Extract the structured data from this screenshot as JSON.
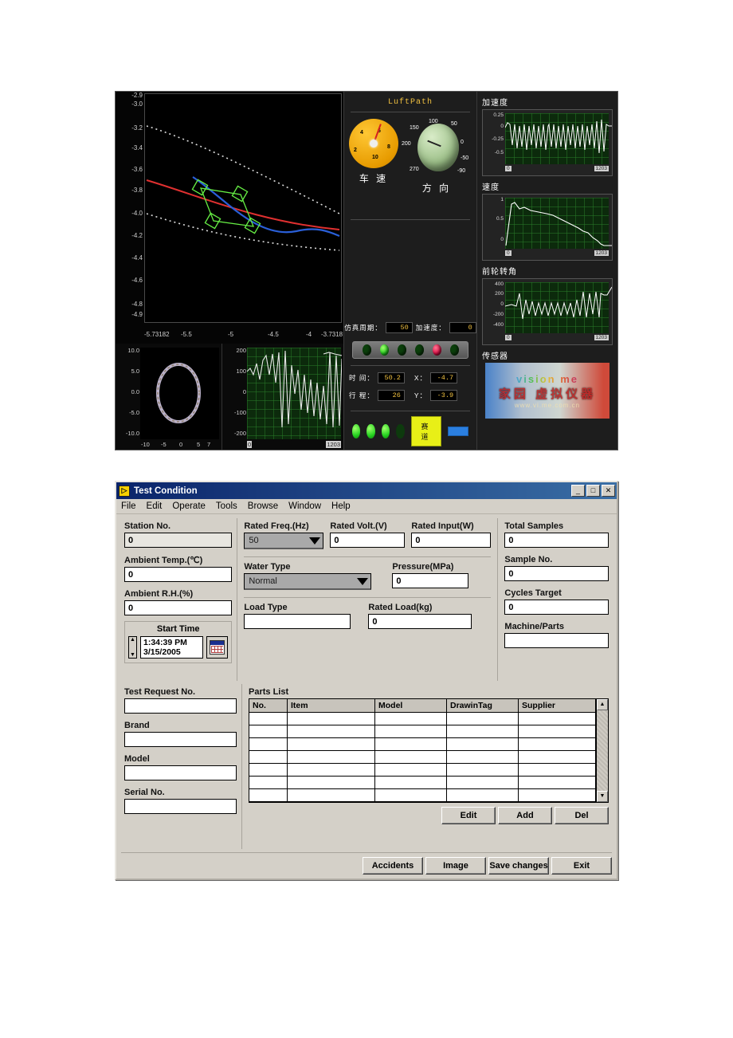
{
  "instrument_panel": {
    "title": "LuftPath",
    "main_plot": {
      "y_ticks": [
        "-2.9",
        "-3.0",
        "-3.2",
        "-3.4",
        "-3.6",
        "-3.8",
        "-4.0",
        "-4.2",
        "-4.4",
        "-4.6",
        "-4.8",
        "-4.9"
      ],
      "x_ticks": [
        "-5.73182",
        "-5.5",
        "-5",
        "-4.5",
        "-4",
        "-3.7318"
      ]
    },
    "mini_track": {
      "y_ticks": [
        "10.0",
        "5.0",
        "0.0",
        "-5.0",
        "-10.0"
      ],
      "x_ticks": [
        "-10",
        "-5",
        "0",
        "5",
        "7"
      ]
    },
    "mini_wave": {
      "y_ticks": [
        "200",
        "100",
        "0",
        "-100",
        "-200"
      ],
      "x_start": "0",
      "x_end": "1203"
    },
    "gauges": {
      "speed": {
        "label": "车 速",
        "ticks": [
          "2",
          "4",
          "6",
          "8",
          "10"
        ]
      },
      "direction": {
        "label": "方 向",
        "ticks": [
          "100",
          "150",
          "50",
          "200",
          "0",
          "270",
          "-50",
          "-90"
        ]
      }
    },
    "readouts": {
      "sim_cycle_label": "仿真周期：",
      "sim_cycle_value": "50",
      "accel_label": "加速度：",
      "accel_value": "0",
      "time_label": "时 间：",
      "time_value": "50.2",
      "x_label": "X：",
      "x_value": "-4.7",
      "distance_label": "行 程：",
      "distance_value": "26",
      "y_label": "Y：",
      "y_value": "-3.9"
    },
    "buttons": {
      "track": "赛道",
      "blue": ""
    },
    "charts": [
      {
        "title": "加速度",
        "y_ticks": [
          "0.25",
          "0",
          "-0.25",
          "-0.5"
        ],
        "x_start": "0",
        "x_end": "1203"
      },
      {
        "title": "速度",
        "y_ticks": [
          "1",
          "0.5",
          "0"
        ],
        "x_start": "0",
        "x_end": "1203"
      },
      {
        "title": "前轮转角",
        "y_ticks": [
          "400",
          "200",
          "0",
          "-200",
          "-400"
        ],
        "x_start": "0",
        "x_end": "1203"
      }
    ],
    "sensor": {
      "title": "传感器",
      "watermark_line1": "vision me",
      "watermark_line2": "家园 虚拟仪器",
      "watermark_line3": "www.vi.me.com.cn"
    }
  },
  "dialog": {
    "title": "Test Condition",
    "window_buttons": {
      "minimize": "_",
      "maximize": "□",
      "close": "✕"
    },
    "menu": [
      "File",
      "Edit",
      "Operate",
      "Tools",
      "Browse",
      "Window",
      "Help"
    ],
    "left_column": {
      "station_no_label": "Station No.",
      "station_no_value": "0",
      "ambient_temp_label": "Ambient Temp.(℃)",
      "ambient_temp_value": "0",
      "ambient_rh_label": "Ambient R.H.(%)",
      "ambient_rh_value": "0",
      "start_time_label": "Start Time",
      "start_time_time": "1:34:39 PM",
      "start_time_date": "3/15/2005"
    },
    "middle_column": {
      "rated_freq_label": "Rated Freq.(Hz)",
      "rated_freq_value": "50",
      "rated_volt_label": "Rated Volt.(V)",
      "rated_volt_value": "0",
      "rated_input_label": "Rated Input(W)",
      "rated_input_value": "0",
      "water_type_label": "Water Type",
      "water_type_value": "Normal",
      "pressure_label": "Pressure(MPa)",
      "pressure_value": "0",
      "load_type_label": "Load Type",
      "load_type_value": "",
      "rated_load_label": "Rated Load(kg)",
      "rated_load_value": "0"
    },
    "right_column": {
      "total_samples_label": "Total Samples",
      "total_samples_value": "0",
      "sample_no_label": "Sample No.",
      "sample_no_value": "0",
      "cycles_target_label": "Cycles Target",
      "cycles_target_value": "0",
      "machine_parts_label": "Machine/Parts",
      "machine_parts_value": ""
    },
    "bottom_left": {
      "test_request_label": "Test Request No.",
      "test_request_value": "",
      "brand_label": "Brand",
      "brand_value": "",
      "model_label": "Model",
      "model_value": "",
      "serial_label": "Serial No.",
      "serial_value": ""
    },
    "parts_list": {
      "title": "Parts List",
      "columns": [
        "No.",
        "Item",
        "Model",
        "DrawinTag",
        "Supplier"
      ],
      "rows": [
        [
          "",
          "",
          "",
          "",
          ""
        ],
        [
          "",
          "",
          "",
          "",
          ""
        ],
        [
          "",
          "",
          "",
          "",
          ""
        ],
        [
          "",
          "",
          "",
          "",
          ""
        ],
        [
          "",
          "",
          "",
          "",
          ""
        ],
        [
          "",
          "",
          "",
          "",
          ""
        ],
        [
          "",
          "",
          "",
          "",
          ""
        ]
      ],
      "buttons": [
        "Edit",
        "Add",
        "Del"
      ],
      "scroll_up": "▲",
      "scroll_down": "▼"
    },
    "footer_buttons": [
      "Accidents",
      "Image",
      "Save changes",
      "Exit"
    ]
  }
}
